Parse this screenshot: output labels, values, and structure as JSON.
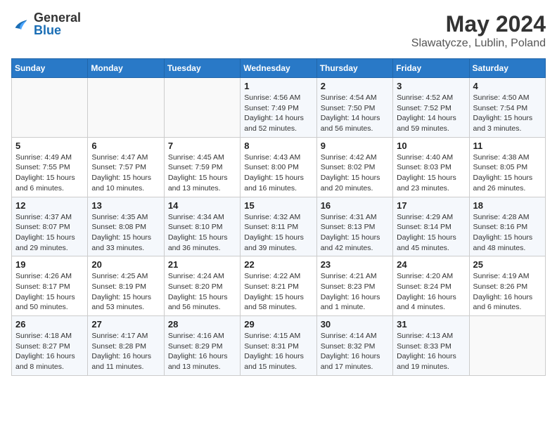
{
  "header": {
    "logo": {
      "general": "General",
      "blue": "Blue"
    },
    "title": "May 2024",
    "location": "Slawatycze, Lublin, Poland"
  },
  "weekdays": [
    "Sunday",
    "Monday",
    "Tuesday",
    "Wednesday",
    "Thursday",
    "Friday",
    "Saturday"
  ],
  "weeks": [
    [
      {
        "day": "",
        "info": ""
      },
      {
        "day": "",
        "info": ""
      },
      {
        "day": "",
        "info": ""
      },
      {
        "day": "1",
        "info": "Sunrise: 4:56 AM\nSunset: 7:49 PM\nDaylight: 14 hours and 52 minutes."
      },
      {
        "day": "2",
        "info": "Sunrise: 4:54 AM\nSunset: 7:50 PM\nDaylight: 14 hours and 56 minutes."
      },
      {
        "day": "3",
        "info": "Sunrise: 4:52 AM\nSunset: 7:52 PM\nDaylight: 14 hours and 59 minutes."
      },
      {
        "day": "4",
        "info": "Sunrise: 4:50 AM\nSunset: 7:54 PM\nDaylight: 15 hours and 3 minutes."
      }
    ],
    [
      {
        "day": "5",
        "info": "Sunrise: 4:49 AM\nSunset: 7:55 PM\nDaylight: 15 hours and 6 minutes."
      },
      {
        "day": "6",
        "info": "Sunrise: 4:47 AM\nSunset: 7:57 PM\nDaylight: 15 hours and 10 minutes."
      },
      {
        "day": "7",
        "info": "Sunrise: 4:45 AM\nSunset: 7:59 PM\nDaylight: 15 hours and 13 minutes."
      },
      {
        "day": "8",
        "info": "Sunrise: 4:43 AM\nSunset: 8:00 PM\nDaylight: 15 hours and 16 minutes."
      },
      {
        "day": "9",
        "info": "Sunrise: 4:42 AM\nSunset: 8:02 PM\nDaylight: 15 hours and 20 minutes."
      },
      {
        "day": "10",
        "info": "Sunrise: 4:40 AM\nSunset: 8:03 PM\nDaylight: 15 hours and 23 minutes."
      },
      {
        "day": "11",
        "info": "Sunrise: 4:38 AM\nSunset: 8:05 PM\nDaylight: 15 hours and 26 minutes."
      }
    ],
    [
      {
        "day": "12",
        "info": "Sunrise: 4:37 AM\nSunset: 8:07 PM\nDaylight: 15 hours and 29 minutes."
      },
      {
        "day": "13",
        "info": "Sunrise: 4:35 AM\nSunset: 8:08 PM\nDaylight: 15 hours and 33 minutes."
      },
      {
        "day": "14",
        "info": "Sunrise: 4:34 AM\nSunset: 8:10 PM\nDaylight: 15 hours and 36 minutes."
      },
      {
        "day": "15",
        "info": "Sunrise: 4:32 AM\nSunset: 8:11 PM\nDaylight: 15 hours and 39 minutes."
      },
      {
        "day": "16",
        "info": "Sunrise: 4:31 AM\nSunset: 8:13 PM\nDaylight: 15 hours and 42 minutes."
      },
      {
        "day": "17",
        "info": "Sunrise: 4:29 AM\nSunset: 8:14 PM\nDaylight: 15 hours and 45 minutes."
      },
      {
        "day": "18",
        "info": "Sunrise: 4:28 AM\nSunset: 8:16 PM\nDaylight: 15 hours and 48 minutes."
      }
    ],
    [
      {
        "day": "19",
        "info": "Sunrise: 4:26 AM\nSunset: 8:17 PM\nDaylight: 15 hours and 50 minutes."
      },
      {
        "day": "20",
        "info": "Sunrise: 4:25 AM\nSunset: 8:19 PM\nDaylight: 15 hours and 53 minutes."
      },
      {
        "day": "21",
        "info": "Sunrise: 4:24 AM\nSunset: 8:20 PM\nDaylight: 15 hours and 56 minutes."
      },
      {
        "day": "22",
        "info": "Sunrise: 4:22 AM\nSunset: 8:21 PM\nDaylight: 15 hours and 58 minutes."
      },
      {
        "day": "23",
        "info": "Sunrise: 4:21 AM\nSunset: 8:23 PM\nDaylight: 16 hours and 1 minute."
      },
      {
        "day": "24",
        "info": "Sunrise: 4:20 AM\nSunset: 8:24 PM\nDaylight: 16 hours and 4 minutes."
      },
      {
        "day": "25",
        "info": "Sunrise: 4:19 AM\nSunset: 8:26 PM\nDaylight: 16 hours and 6 minutes."
      }
    ],
    [
      {
        "day": "26",
        "info": "Sunrise: 4:18 AM\nSunset: 8:27 PM\nDaylight: 16 hours and 8 minutes."
      },
      {
        "day": "27",
        "info": "Sunrise: 4:17 AM\nSunset: 8:28 PM\nDaylight: 16 hours and 11 minutes."
      },
      {
        "day": "28",
        "info": "Sunrise: 4:16 AM\nSunset: 8:29 PM\nDaylight: 16 hours and 13 minutes."
      },
      {
        "day": "29",
        "info": "Sunrise: 4:15 AM\nSunset: 8:31 PM\nDaylight: 16 hours and 15 minutes."
      },
      {
        "day": "30",
        "info": "Sunrise: 4:14 AM\nSunset: 8:32 PM\nDaylight: 16 hours and 17 minutes."
      },
      {
        "day": "31",
        "info": "Sunrise: 4:13 AM\nSunset: 8:33 PM\nDaylight: 16 hours and 19 minutes."
      },
      {
        "day": "",
        "info": ""
      }
    ]
  ]
}
